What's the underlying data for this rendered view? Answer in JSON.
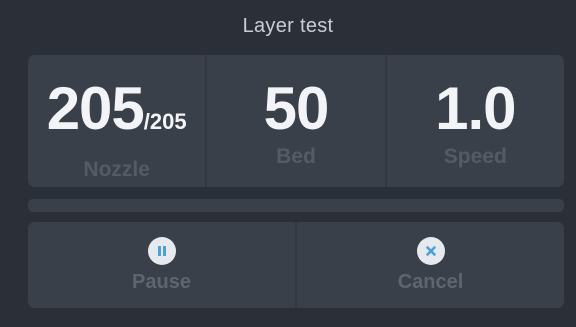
{
  "header": {
    "title": "Layer test"
  },
  "stats": {
    "nozzle": {
      "value": "205",
      "target": "/205",
      "label": "Nozzle"
    },
    "bed": {
      "value": "50",
      "label": "Bed"
    },
    "speed": {
      "value": "1.0",
      "label": "Speed"
    }
  },
  "progress": {
    "percent": 0
  },
  "actions": {
    "pause": {
      "label": "Pause",
      "icon": "pause-icon"
    },
    "cancel": {
      "label": "Cancel",
      "icon": "close-icon"
    }
  },
  "colors": {
    "background": "#2b3038",
    "panel": "#3a404a",
    "icon_accent": "#4a9fd8"
  }
}
